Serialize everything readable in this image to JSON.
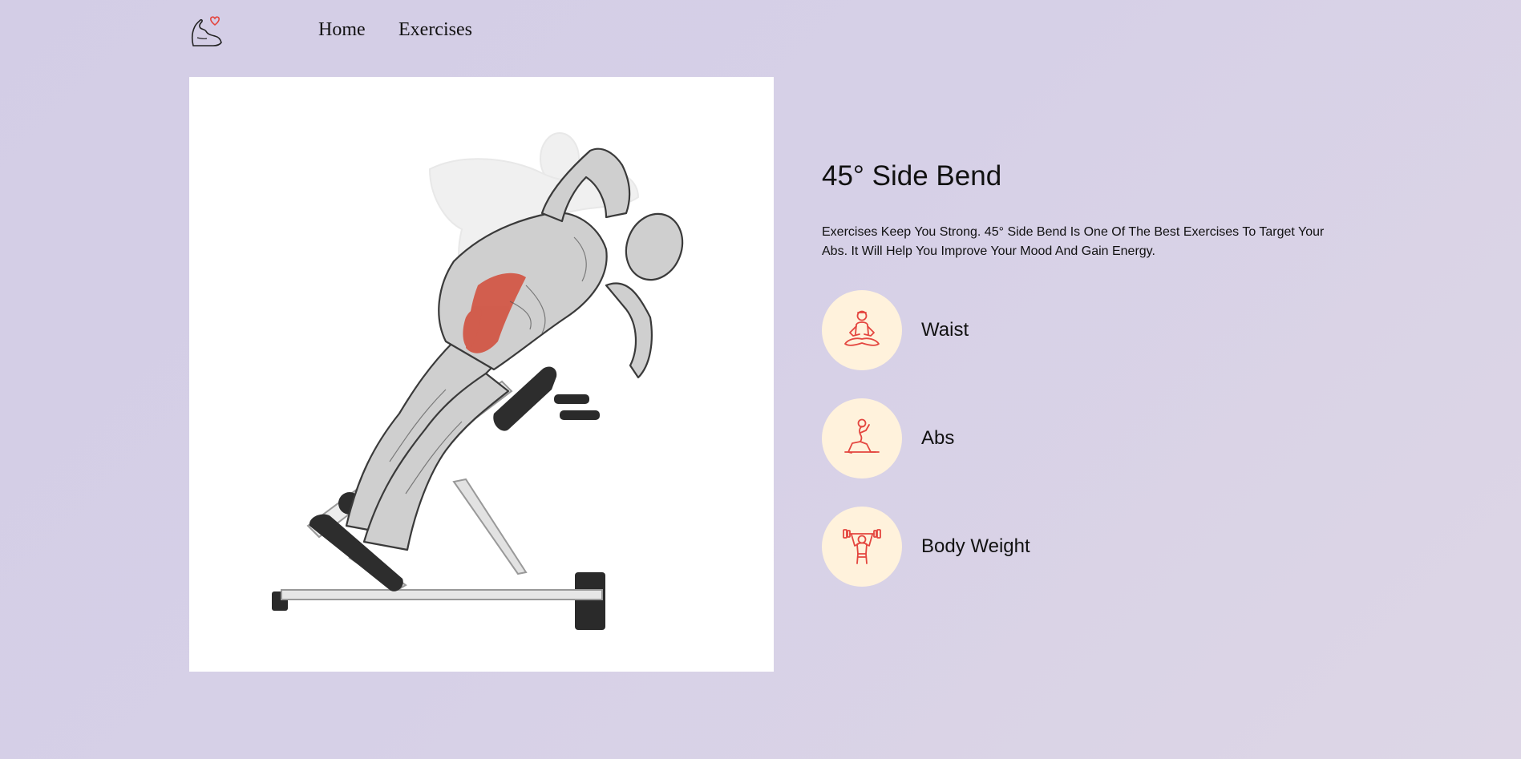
{
  "nav": {
    "logo_icon": "flexed-arm-heart-icon",
    "links": [
      "Home",
      "Exercises"
    ]
  },
  "exercise": {
    "image_icon": "side-bend-illustration",
    "title": "45° Side Bend",
    "description": "Exercises Keep You Strong. 45° Side Bend Is One Of The Best Exercises To Target Your Abs. It Will Help You Improve Your Mood And Gain Energy.",
    "tags": [
      {
        "label": "Waist",
        "icon": "meditation-icon"
      },
      {
        "label": "Abs",
        "icon": "lunge-icon"
      },
      {
        "label": "Body Weight",
        "icon": "dumbbell-press-icon"
      }
    ]
  },
  "colors": {
    "background": "#d6d0e7",
    "tag_circle": "#fff2dc",
    "icon_red": "#e4463f",
    "muscle_highlight": "#d24a37"
  }
}
